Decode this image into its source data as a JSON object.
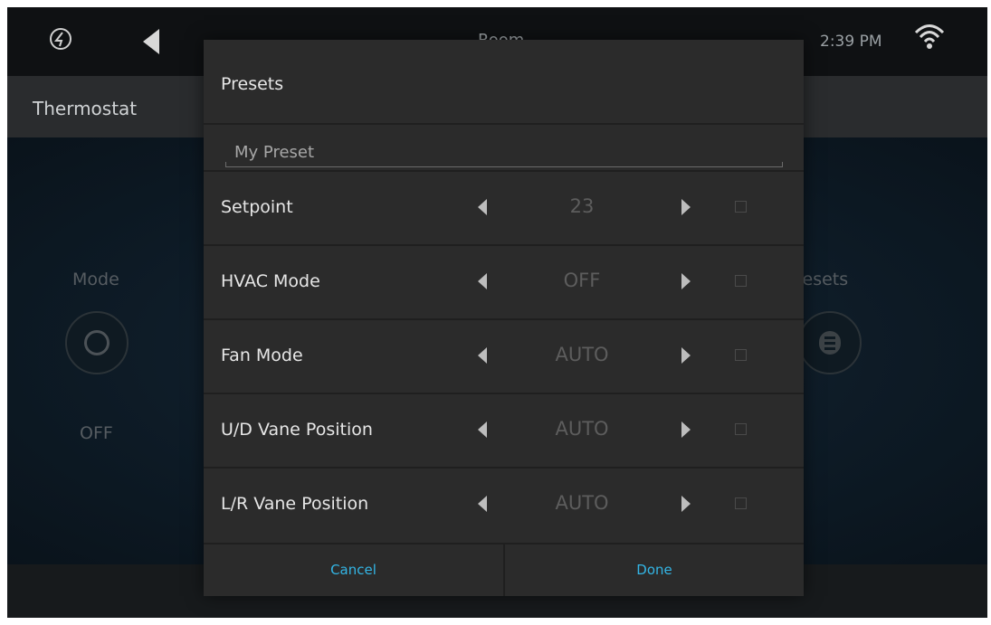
{
  "status_bar": {
    "title": "Room",
    "time": "2:39 PM",
    "icons": [
      "brand-logo-icon",
      "back-arrow-icon",
      "wifi-icon"
    ]
  },
  "header": {
    "title": "Thermostat"
  },
  "main": {
    "mode_label": "Mode",
    "mode_value": "OFF",
    "presets_label": "Presets",
    "icons": [
      "power-ring-icon",
      "presets-menu-icon"
    ]
  },
  "dialog": {
    "title": "Presets",
    "preset_name": "My Preset",
    "rows": [
      {
        "label": "Setpoint",
        "value": "23"
      },
      {
        "label": "HVAC Mode",
        "value": "OFF"
      },
      {
        "label": "Fan Mode",
        "value": "AUTO"
      },
      {
        "label": "U/D Vane Position",
        "value": "AUTO"
      },
      {
        "label": "L/R Vane Position",
        "value": "AUTO"
      }
    ],
    "cancel_label": "Cancel",
    "done_label": "Done",
    "accent_color": "#33b5e5"
  }
}
